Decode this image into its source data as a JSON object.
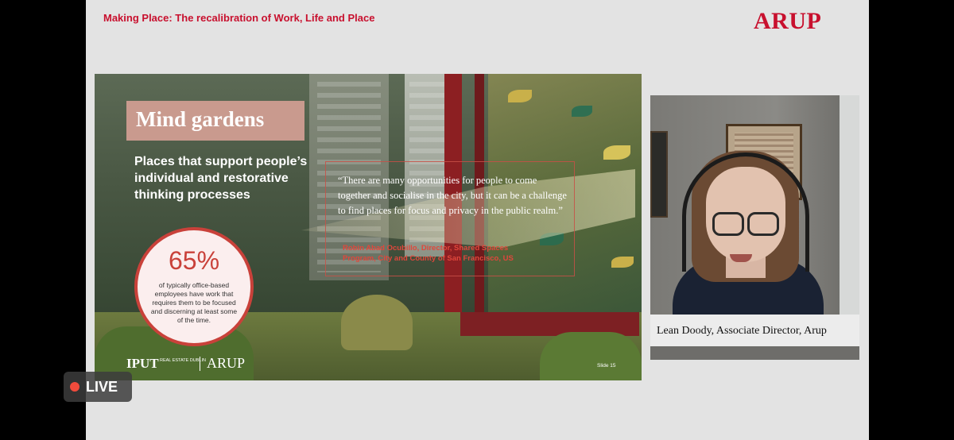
{
  "header": {
    "title": "Making Place: The recalibration of Work, Life and Place",
    "brand": "ARUP"
  },
  "slide": {
    "title": "Mind gardens",
    "subtitle": "Places that support people’s individual and restorative thinking processes",
    "quote": "“There are many opportunities for people to come together and socialise in the city, but it can be a challenge to find places for focus and privacy in the public realm.”",
    "attribution": "Robin Abad Ocubillo, Director, Shared Spaces Program, City and County of San Francisco, US",
    "stat": {
      "value": "65%",
      "text": "of typically office-based employees have work that requires them to be focused and discerning at least some of the time."
    },
    "logos": {
      "iput": "IPUT",
      "iput_sub": "REAL ESTATE DUBLIN",
      "arup": "ARUP"
    },
    "slide_number": "Slide 15"
  },
  "speaker": {
    "caption": "Lean Doody, Associate Director, Arup"
  },
  "live_badge": {
    "label": "LIVE",
    "color": "#f04b3c"
  },
  "colors": {
    "accent": "#c8102e",
    "title_box": "#c99a8e"
  }
}
